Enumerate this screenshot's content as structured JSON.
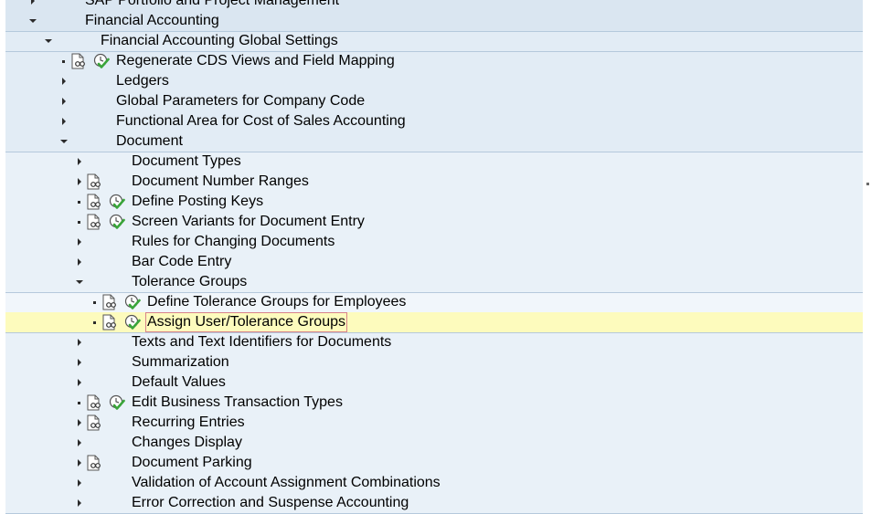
{
  "tree": {
    "rows": [
      {
        "label": "SAP Portfolio and Project Management",
        "state": "collapsed",
        "doc": false,
        "exec": false,
        "bullet": false
      },
      {
        "label": "Financial Accounting",
        "state": "expanded",
        "doc": false,
        "exec": false,
        "bullet": false
      },
      {
        "label": "Financial Accounting Global Settings",
        "state": "expanded",
        "doc": false,
        "exec": false,
        "bullet": false
      },
      {
        "label": "Regenerate CDS Views and Field Mapping",
        "state": "leaf",
        "doc": true,
        "exec": true,
        "bullet": true
      },
      {
        "label": "Ledgers",
        "state": "collapsed",
        "doc": false,
        "exec": false,
        "bullet": false
      },
      {
        "label": "Global Parameters for Company Code",
        "state": "collapsed",
        "doc": false,
        "exec": false,
        "bullet": false
      },
      {
        "label": "Functional Area for Cost of Sales Accounting",
        "state": "collapsed",
        "doc": false,
        "exec": false,
        "bullet": false
      },
      {
        "label": "Document",
        "state": "expanded",
        "doc": false,
        "exec": false,
        "bullet": false
      },
      {
        "label": "Document Types",
        "state": "collapsed",
        "doc": false,
        "exec": false,
        "bullet": false
      },
      {
        "label": "Document Number Ranges",
        "state": "collapsed",
        "doc": true,
        "exec": false,
        "bullet": false
      },
      {
        "label": "Define Posting Keys",
        "state": "leaf",
        "doc": true,
        "exec": true,
        "bullet": true
      },
      {
        "label": "Screen Variants for Document Entry",
        "state": "leaf",
        "doc": true,
        "exec": true,
        "bullet": true
      },
      {
        "label": "Rules for Changing Documents",
        "state": "collapsed",
        "doc": false,
        "exec": false,
        "bullet": false
      },
      {
        "label": "Bar Code Entry",
        "state": "collapsed",
        "doc": false,
        "exec": false,
        "bullet": false
      },
      {
        "label": "Tolerance Groups",
        "state": "expanded",
        "doc": false,
        "exec": false,
        "bullet": false
      },
      {
        "label": "Define Tolerance Groups for Employees",
        "state": "leaf",
        "doc": true,
        "exec": true,
        "bullet": true
      },
      {
        "label": "Assign User/Tolerance Groups",
        "state": "leaf",
        "doc": true,
        "exec": true,
        "bullet": true,
        "selected": true
      },
      {
        "label": "Texts and Text Identifiers for Documents",
        "state": "collapsed",
        "doc": false,
        "exec": false,
        "bullet": false
      },
      {
        "label": "Summarization",
        "state": "collapsed",
        "doc": false,
        "exec": false,
        "bullet": false
      },
      {
        "label": "Default Values",
        "state": "collapsed",
        "doc": false,
        "exec": false,
        "bullet": false
      },
      {
        "label": "Edit Business Transaction Types",
        "state": "leaf",
        "doc": true,
        "exec": true,
        "bullet": true
      },
      {
        "label": "Recurring Entries",
        "state": "collapsed",
        "doc": true,
        "exec": false,
        "bullet": false
      },
      {
        "label": "Changes Display",
        "state": "collapsed",
        "doc": false,
        "exec": false,
        "bullet": false
      },
      {
        "label": "Document Parking",
        "state": "collapsed",
        "doc": true,
        "exec": false,
        "bullet": false
      },
      {
        "label": "Validation of Account Assignment Combinations",
        "state": "collapsed",
        "doc": false,
        "exec": false,
        "bullet": false
      },
      {
        "label": "Error Correction and Suspense Accounting",
        "state": "collapsed",
        "doc": false,
        "exec": false,
        "bullet": false
      }
    ]
  },
  "colors": {
    "selected_row": "#fdfbbd",
    "exec_check": "#3aa53a",
    "divider": "#b5c9dc"
  },
  "icons": {
    "doc": "documentation-icon",
    "exec": "execute-clock-check-icon"
  }
}
